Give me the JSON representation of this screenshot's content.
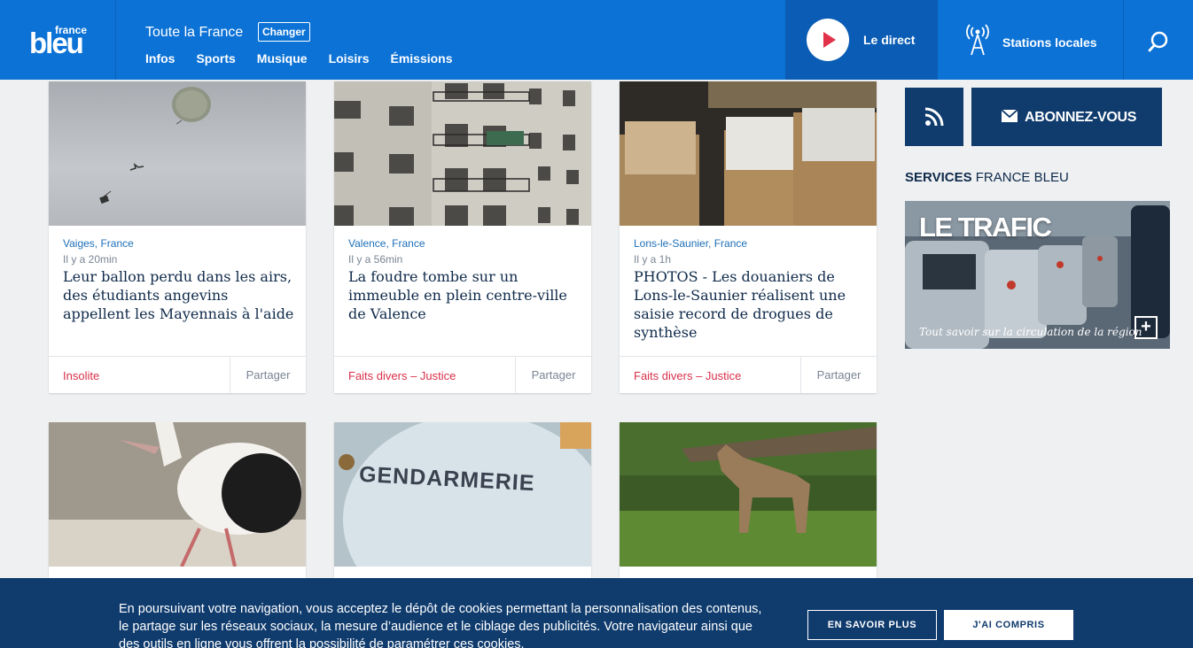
{
  "header": {
    "logo_top": "france",
    "logo_main": "bleu",
    "region": "Toute la France",
    "changer": "Changer",
    "nav": [
      "Infos",
      "Sports",
      "Musique",
      "Loisirs",
      "Émissions"
    ],
    "direct": "Le direct",
    "stations": "Stations locales"
  },
  "cards": [
    {
      "location": "Vaiges, France",
      "time": "Il y a 20min",
      "title": "Leur ballon perdu dans les airs, des étudiants angevins appellent les Mayennais à l'aide",
      "category": "Insolite",
      "share": "Partager"
    },
    {
      "location": "Valence, France",
      "time": "Il y a 56min",
      "title": "La foudre tombe sur un immeuble en plein centre-ville de Valence",
      "category": "Faits divers – Justice",
      "share": "Partager"
    },
    {
      "location": "Lons-le-Saunier, France",
      "time": "Il y a 1h",
      "title": "PHOTOS - Les douaniers de Lons-le-Saunier réalisent une saisie record de drogues de synthèse",
      "category": "Faits divers – Justice",
      "share": "Partager"
    }
  ],
  "second_row": {
    "gendarmerie_text": "GENDARMERIE"
  },
  "sidebar": {
    "abonnez": "ABONNEZ-VOUS",
    "services_bold": "SERVICES",
    "services_rest": "FRANCE BLEU",
    "trafic_title": "LE TRAFIC",
    "trafic_sub": "Tout savoir sur la circulation de la région",
    "trafic_plus": "+"
  },
  "cookie": {
    "message": "En poursuivant votre navigation, vous acceptez le dépôt de cookies permettant la personnalisation des contenus, le partage sur les réseaux sociaux, la mesure d’audience et le ciblage des publicités. Votre navigateur ainsi que des outils en ligne vous offrent la possibilité de paramétrer ces cookies.",
    "more": "EN SAVOIR PLUS",
    "ok": "J'AI COMPRIS"
  }
}
